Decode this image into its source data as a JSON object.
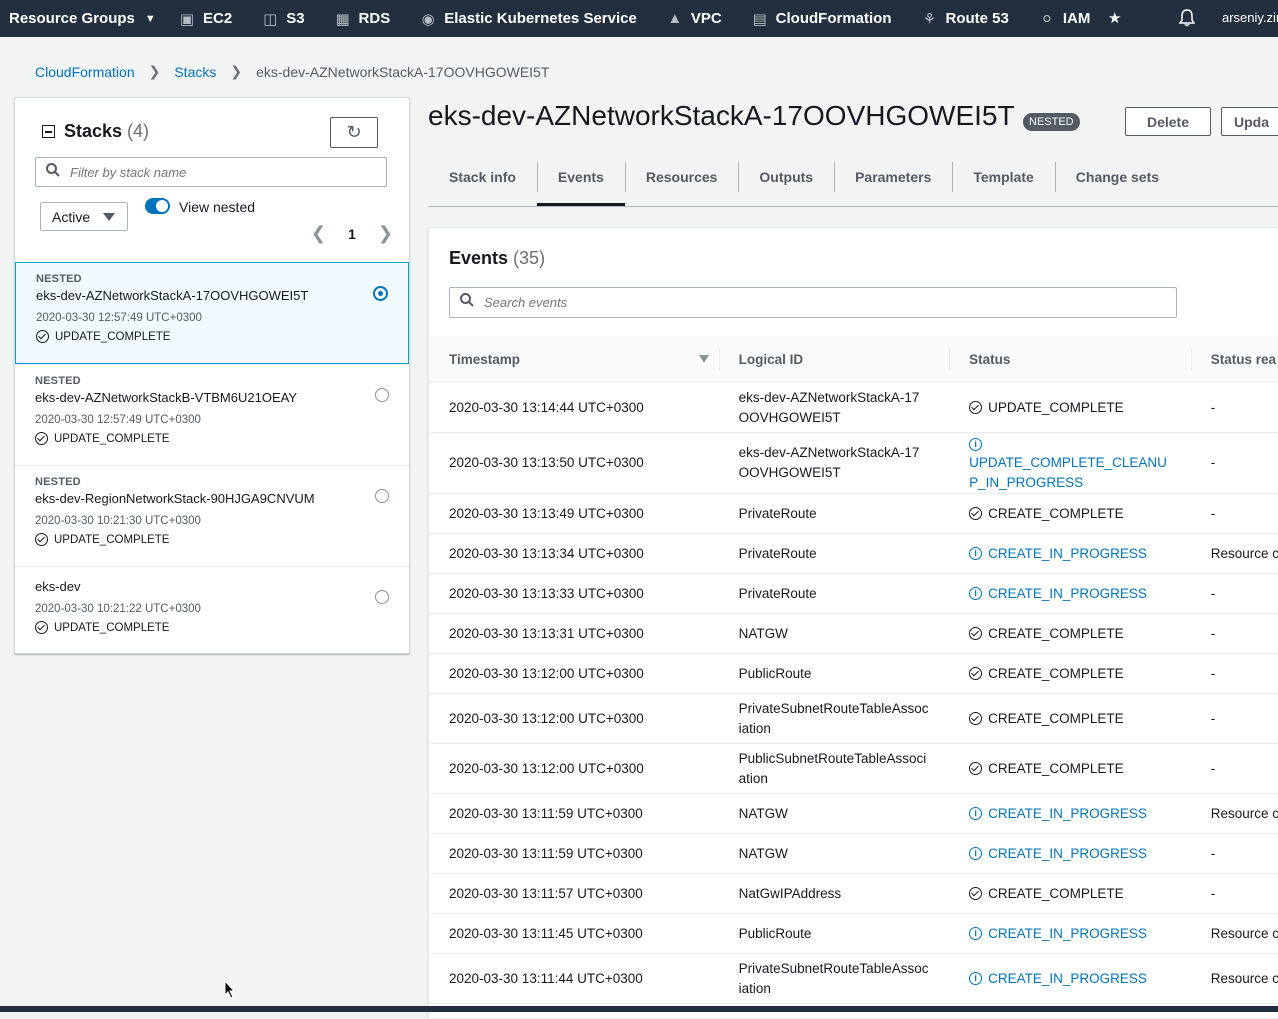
{
  "topnav": {
    "resource_groups": "Resource Groups",
    "services": [
      "EC2",
      "S3",
      "RDS",
      "Elastic Kubernetes Service",
      "VPC",
      "CloudFormation",
      "Route 53",
      "IAM"
    ],
    "user": "arseniy.zin"
  },
  "breadcrumb": {
    "root": "CloudFormation",
    "stacks": "Stacks",
    "current": "eks-dev-AZNetworkStackA-17OOVHGOWEI5T"
  },
  "stacks_panel": {
    "title": "Stacks",
    "count": "(4)",
    "filter_placeholder": "Filter by stack name",
    "status_filter": "Active",
    "view_nested_label": "View nested",
    "page": "1",
    "items": [
      {
        "nested": "NESTED",
        "name": "eks-dev-AZNetworkStackA-17OOVHGOWEI5T",
        "time": "2020-03-30 12:57:49 UTC+0300",
        "status": "UPDATE_COMPLETE"
      },
      {
        "nested": "NESTED",
        "name": "eks-dev-AZNetworkStackB-VTBM6U21OEAY",
        "time": "2020-03-30 12:57:49 UTC+0300",
        "status": "UPDATE_COMPLETE"
      },
      {
        "nested": "NESTED",
        "name": "eks-dev-RegionNetworkStack-90HJGA9CNVUM",
        "time": "2020-03-30 10:21:30 UTC+0300",
        "status": "UPDATE_COMPLETE"
      },
      {
        "nested": "",
        "name": "eks-dev",
        "time": "2020-03-30 10:21:22 UTC+0300",
        "status": "UPDATE_COMPLETE"
      }
    ]
  },
  "stack": {
    "title": "eks-dev-AZNetworkStackA-17OOVHGOWEI5T",
    "badge": "NESTED",
    "delete_label": "Delete",
    "update_label": "Upda"
  },
  "tabs": [
    "Stack info",
    "Events",
    "Resources",
    "Outputs",
    "Parameters",
    "Template",
    "Change sets"
  ],
  "events": {
    "title": "Events",
    "count": "(35)",
    "search_placeholder": "Search events",
    "columns": [
      "Timestamp",
      "Logical ID",
      "Status",
      "Status rea"
    ],
    "rows": [
      {
        "ts": "2020-03-30 13:14:44 UTC+0300",
        "lid": "eks-dev-AZNetworkStackA-17OOVHGOWEI5T",
        "status": "UPDATE_COMPLETE",
        "reason": "-"
      },
      {
        "ts": "2020-03-30 13:13:50 UTC+0300",
        "lid": "eks-dev-AZNetworkStackA-17OOVHGOWEI5T",
        "status": "UPDATE_COMPLETE_CLEANUP_IN_PROGRESS",
        "reason": "-"
      },
      {
        "ts": "2020-03-30 13:13:49 UTC+0300",
        "lid": "PrivateRoute",
        "status": "CREATE_COMPLETE",
        "reason": "-"
      },
      {
        "ts": "2020-03-30 13:13:34 UTC+0300",
        "lid": "PrivateRoute",
        "status": "CREATE_IN_PROGRESS",
        "reason": "Resource c"
      },
      {
        "ts": "2020-03-30 13:13:33 UTC+0300",
        "lid": "PrivateRoute",
        "status": "CREATE_IN_PROGRESS",
        "reason": "-"
      },
      {
        "ts": "2020-03-30 13:13:31 UTC+0300",
        "lid": "NATGW",
        "status": "CREATE_COMPLETE",
        "reason": "-"
      },
      {
        "ts": "2020-03-30 13:12:00 UTC+0300",
        "lid": "PublicRoute",
        "status": "CREATE_COMPLETE",
        "reason": "-"
      },
      {
        "ts": "2020-03-30 13:12:00 UTC+0300",
        "lid": "PrivateSubnetRouteTableAssociation",
        "status": "CREATE_COMPLETE",
        "reason": "-"
      },
      {
        "ts": "2020-03-30 13:12:00 UTC+0300",
        "lid": "PublicSubnetRouteTableAssociation",
        "status": "CREATE_COMPLETE",
        "reason": "-"
      },
      {
        "ts": "2020-03-30 13:11:59 UTC+0300",
        "lid": "NATGW",
        "status": "CREATE_IN_PROGRESS",
        "reason": "Resource c"
      },
      {
        "ts": "2020-03-30 13:11:59 UTC+0300",
        "lid": "NATGW",
        "status": "CREATE_IN_PROGRESS",
        "reason": "-"
      },
      {
        "ts": "2020-03-30 13:11:57 UTC+0300",
        "lid": "NatGwIPAddress",
        "status": "CREATE_COMPLETE",
        "reason": "-"
      },
      {
        "ts": "2020-03-30 13:11:45 UTC+0300",
        "lid": "PublicRoute",
        "status": "CREATE_IN_PROGRESS",
        "reason": "Resource c"
      },
      {
        "ts": "2020-03-30 13:11:44 UTC+0300",
        "lid": "PrivateSubnetRouteTableAssociation",
        "status": "CREATE_IN_PROGRESS",
        "reason": "Resource c"
      }
    ]
  },
  "colors": {
    "nav_bg": "#232f3e",
    "link": "#0073bb",
    "selected_border": "#00a1c9",
    "page_bg": "#f2f3f3"
  }
}
